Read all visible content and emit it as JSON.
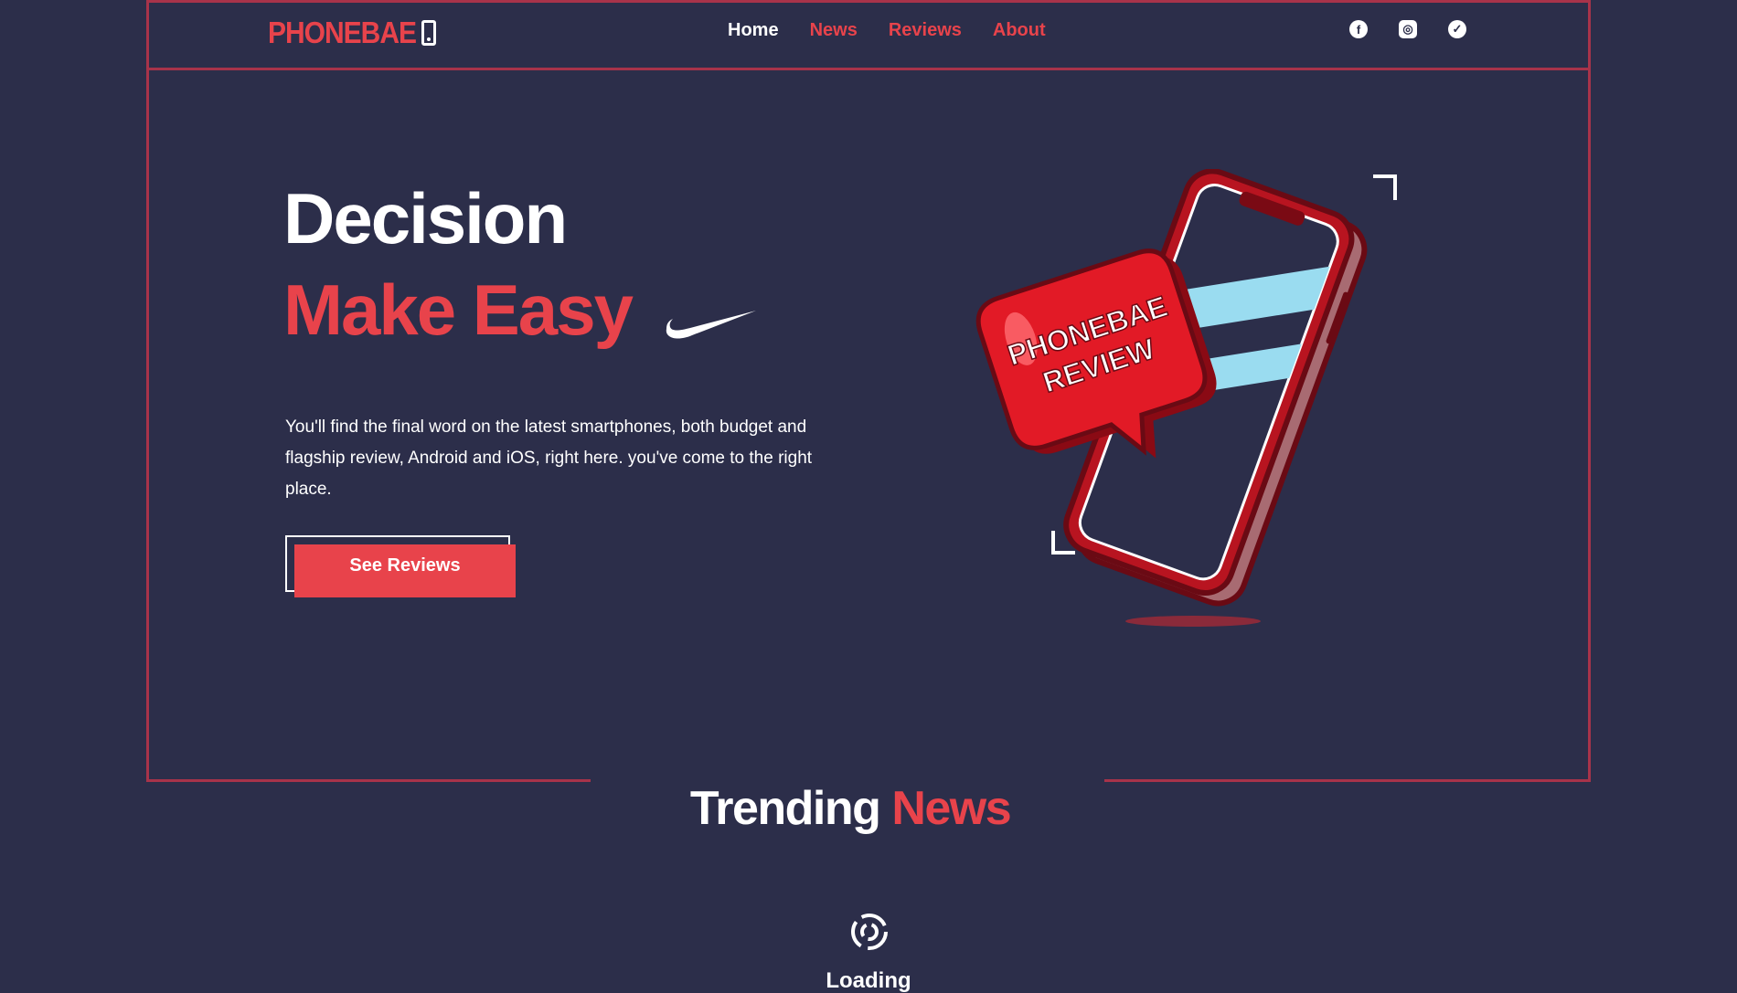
{
  "brand": {
    "name": "PHONEBAE",
    "icon": "smartphone-icon"
  },
  "nav": {
    "items": [
      {
        "label": "Home",
        "active": true
      },
      {
        "label": "News",
        "active": false
      },
      {
        "label": "Reviews",
        "active": false
      },
      {
        "label": "About",
        "active": false
      }
    ]
  },
  "social": [
    {
      "name": "facebook-icon",
      "glyph": "f"
    },
    {
      "name": "instagram-icon",
      "glyph": "◎"
    },
    {
      "name": "twitter-icon",
      "glyph": "✓"
    }
  ],
  "hero": {
    "title_line1": "Decision",
    "title_line2": "Make Easy",
    "description": "You'll find the final word on the latest smartphones, both budget and flagship review, Android and iOS, right here. you've come to the right place.",
    "cta_label": "See Reviews",
    "badge_line1": "PHONEBAE",
    "badge_line2": "REVIEW"
  },
  "trending": {
    "word1": "Trending",
    "word2": "News"
  },
  "loading": {
    "text": "Loading"
  },
  "colors": {
    "background": "#2c2e4a",
    "accent": "#e8434b",
    "frame": "#a8334a",
    "text": "#ffffff"
  }
}
